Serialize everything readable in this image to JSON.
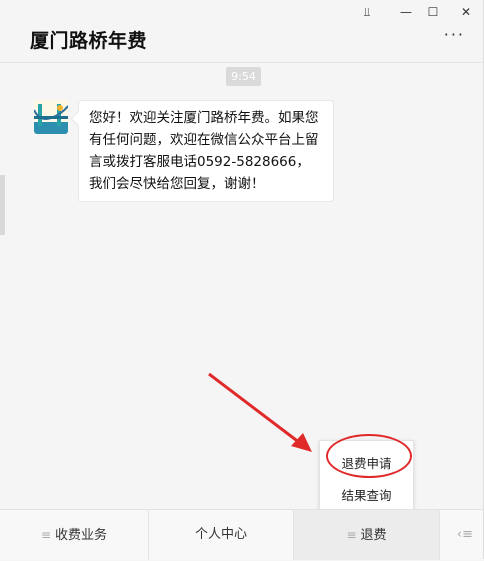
{
  "window": {
    "title": "厦门路桥年费",
    "controls": {
      "pin": "⫫",
      "minimize": "—",
      "maximize": "☐",
      "close": "✕"
    },
    "more_icon": "···"
  },
  "chat": {
    "timestamp": "9:54",
    "message": "您好！欢迎关注厦门路桥年费。如果您有任何问题，欢迎在微信公众平台上留言或拨打客服电话0592-5828666，我们会尽快给您回复，谢谢！"
  },
  "popup_menu": {
    "items": [
      {
        "label": "退费申请"
      },
      {
        "label": "结果查询"
      }
    ]
  },
  "bottom_menu": {
    "items": [
      {
        "label": "收费业务",
        "icon": "≡"
      },
      {
        "label": "个人中心",
        "icon": ""
      },
      {
        "label": "退费",
        "icon": "≡"
      }
    ],
    "keyboard_icon": "‹≡"
  },
  "colors": {
    "annotation_red": "#e02a2a",
    "background": "#f5f5f5"
  }
}
